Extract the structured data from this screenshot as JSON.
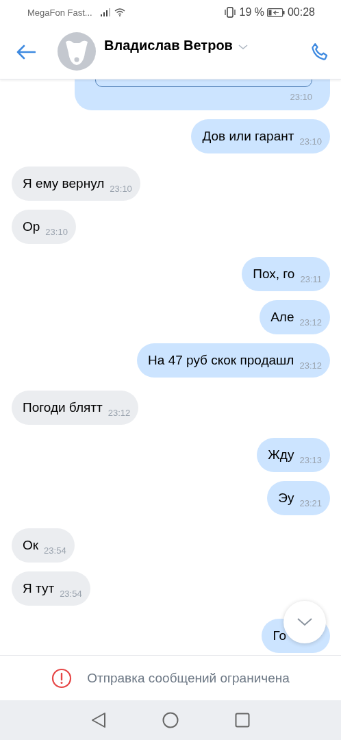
{
  "status_bar": {
    "carrier": "MegaFon Fast...",
    "battery": "19 %",
    "time": "00:28"
  },
  "header": {
    "name": "Владислав Ветров"
  },
  "messages": [
    {
      "kind": "partial",
      "outgoing": true,
      "time": "23:10"
    },
    {
      "kind": "text",
      "outgoing": true,
      "text": "Дов или гарант",
      "time": "23:10"
    },
    {
      "kind": "text",
      "outgoing": false,
      "text": "Я ему вернул",
      "time": "23:10"
    },
    {
      "kind": "text",
      "outgoing": false,
      "text": "Ор",
      "time": "23:10"
    },
    {
      "kind": "text",
      "outgoing": true,
      "text": "Пох, го",
      "time": "23:11"
    },
    {
      "kind": "text",
      "outgoing": true,
      "text": "Але",
      "time": "23:12"
    },
    {
      "kind": "text",
      "outgoing": true,
      "text": "На 47 руб скок продашл",
      "time": "23:12"
    },
    {
      "kind": "text",
      "outgoing": false,
      "text": "Погоди блятт",
      "time": "23:12"
    },
    {
      "kind": "text",
      "outgoing": true,
      "text": "Жду",
      "time": "23:13"
    },
    {
      "kind": "text",
      "outgoing": true,
      "text": "Эу",
      "time": "23:21"
    },
    {
      "kind": "text",
      "outgoing": false,
      "text": "Ок",
      "time": "23:54"
    },
    {
      "kind": "text",
      "outgoing": false,
      "text": "Я тут",
      "time": "23:54"
    },
    {
      "kind": "text",
      "outgoing": true,
      "text": "Го"
    }
  ],
  "notice": {
    "text": "Отправка сообщений ограничена"
  }
}
